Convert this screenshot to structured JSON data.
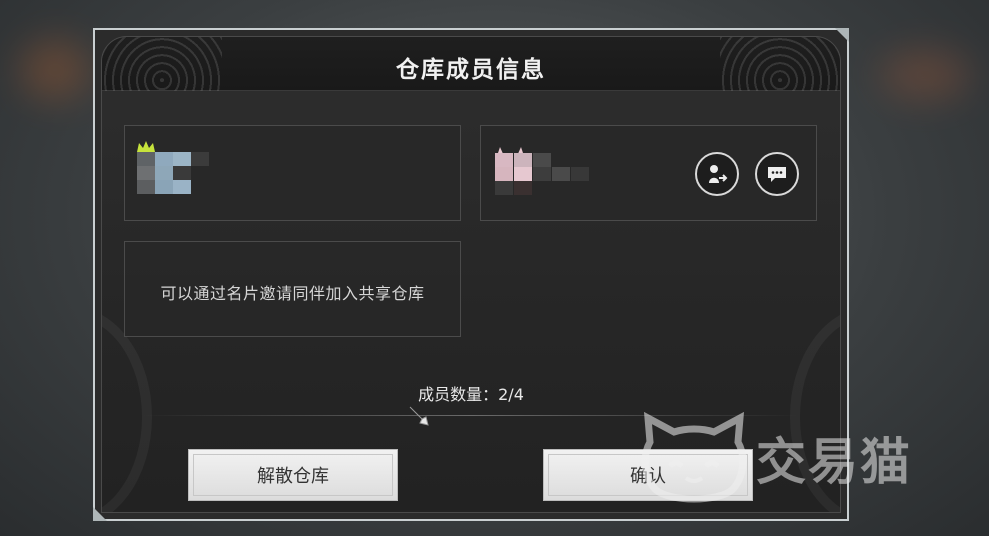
{
  "dialog": {
    "title": "仓库成员信息",
    "invite_hint": "可以通过名片邀请同伴加入共享仓库",
    "member_count_label": "成员数量：",
    "member_count_value": "2/4",
    "disband_label": "解散仓库",
    "confirm_label": "确认"
  },
  "members": [
    {
      "role": "owner",
      "crown_color": "#c6e33c",
      "name_blurred": true
    },
    {
      "role": "member",
      "name_blurred": true,
      "actions": [
        "transfer-icon",
        "chat-icon"
      ]
    }
  ],
  "watermark": {
    "text": "交易猫"
  },
  "colors": {
    "panel_border": "#c9cfd1",
    "button_bg": "#e6e6e6",
    "text_light": "#f1f1f1"
  }
}
